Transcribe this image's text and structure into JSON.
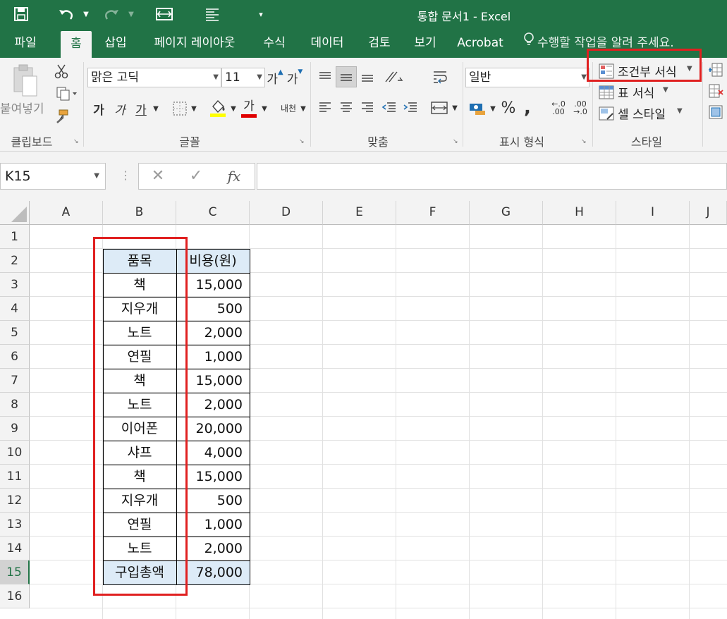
{
  "window": {
    "title": "통합 문서1 - Excel"
  },
  "tabs": [
    "파일",
    "홈",
    "삽입",
    "페이지 레이아웃",
    "수식",
    "데이터",
    "검토",
    "보기",
    "Acrobat"
  ],
  "active_tab": "홈",
  "tellme": "수행할 작업을 알려 주세요.",
  "ribbon": {
    "clipboard": {
      "paste_label": "붙여넣기",
      "group_label": "클립보드"
    },
    "font": {
      "font_name": "맑은 고딕",
      "font_size": "11",
      "bold": "가",
      "italic": "가",
      "underline": "가",
      "font_color_label": "가",
      "phonetic": "내천",
      "group_label": "글꼴",
      "grow": "가",
      "shrink": "가"
    },
    "alignment": {
      "group_label": "맞춤"
    },
    "number": {
      "format": "일반",
      "percent": "%",
      "comma": ",",
      "inc_decimal": "←.0 .00",
      "dec_decimal": ".00 →.0",
      "group_label": "표시 형식"
    },
    "styles": {
      "conditional_formatting": "조건부 서식",
      "format_as_table": "표 서식",
      "cell_styles": "셀 스타일",
      "group_label": "스타일"
    }
  },
  "formula_bar": {
    "name_box": "K15",
    "cancel": "✕",
    "enter": "✓",
    "fx": "fx"
  },
  "sheet": {
    "columns": [
      "A",
      "B",
      "C",
      "D",
      "E",
      "F",
      "G",
      "H",
      "I",
      "J"
    ],
    "rows": [
      "1",
      "2",
      "3",
      "4",
      "5",
      "6",
      "7",
      "8",
      "9",
      "10",
      "11",
      "12",
      "13",
      "14",
      "15",
      "16"
    ],
    "selected_row": "15",
    "table": {
      "header": {
        "item": "품목",
        "cost": "비용(원)"
      },
      "rows": [
        {
          "item": "책",
          "cost": "15,000"
        },
        {
          "item": "지우개",
          "cost": "500"
        },
        {
          "item": "노트",
          "cost": "2,000"
        },
        {
          "item": "연필",
          "cost": "1,000"
        },
        {
          "item": "책",
          "cost": "15,000"
        },
        {
          "item": "노트",
          "cost": "2,000"
        },
        {
          "item": "이어폰",
          "cost": "20,000"
        },
        {
          "item": "샤프",
          "cost": "4,000"
        },
        {
          "item": "책",
          "cost": "15,000"
        },
        {
          "item": "지우개",
          "cost": "500"
        },
        {
          "item": "연필",
          "cost": "1,000"
        },
        {
          "item": "노트",
          "cost": "2,000"
        }
      ],
      "total": {
        "item": "구입총액",
        "cost": "78,000"
      }
    }
  },
  "colors": {
    "excel_green": "#217346",
    "header_fill": "#ddebf7",
    "annotation_red": "#e02020"
  }
}
